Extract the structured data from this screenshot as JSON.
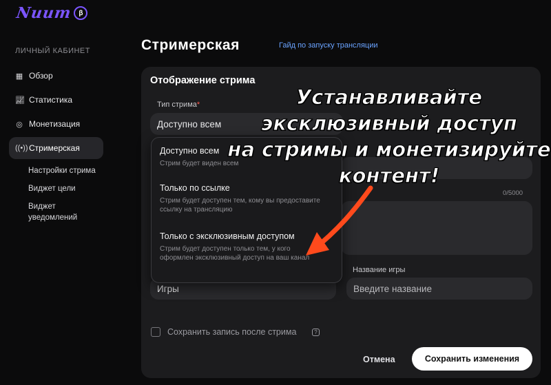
{
  "brand": {
    "logo": "Nuum",
    "beta": "β"
  },
  "sidebar": {
    "section_label": "ЛИЧНЫЙ КАБИНЕТ",
    "items": [
      {
        "label": "Обзор",
        "icon": "grid-icon"
      },
      {
        "label": "Статистика",
        "icon": "chart-icon"
      },
      {
        "label": "Монетизация",
        "icon": "coin-icon"
      },
      {
        "label": "Стримерская",
        "icon": "broadcast-icon"
      }
    ],
    "subitems": [
      {
        "label": "Настройки стрима"
      },
      {
        "label": "Виджет цели"
      },
      {
        "label": "Виджет уведомлений"
      }
    ]
  },
  "header": {
    "title": "Стримерская",
    "guide_link": "Гайд по запуску трансляции"
  },
  "card": {
    "title": "Отображение стрима",
    "stream_type": {
      "label": "Тип стрима",
      "required_mark": "*",
      "value": "Доступно всем"
    },
    "description_counter": "0/5000",
    "category": {
      "value": "Игры"
    },
    "game_name": {
      "label": "Название игры",
      "placeholder": "Введите название"
    },
    "save_record": {
      "label": "Сохранить запись после стрима",
      "help": "?"
    },
    "cancel_label": "Отмена",
    "save_label": "Сохранить изменения"
  },
  "dropdown": {
    "options": [
      {
        "title": "Доступно всем",
        "desc": "Стрим будет виден всем"
      },
      {
        "title": "Только по ссылке",
        "desc": "Стрим будет доступен тем, кому вы предоставите ссылку на трансляцию"
      },
      {
        "title": "Только с эксклюзивным доступом",
        "desc": "Стрим будет доступен только тем, у кого оформлен эксклюзивный доступ на ваш канал"
      }
    ]
  },
  "annotation": {
    "lines": [
      "Устанавливайте",
      "эксклюзивный доступ",
      "на стримы и монетизируйте",
      "контент!"
    ],
    "arrow_color": "#ff4a1c"
  },
  "colors": {
    "accent": "#7b55ff",
    "link": "#6aa3ff",
    "required": "#ff5a4e"
  }
}
